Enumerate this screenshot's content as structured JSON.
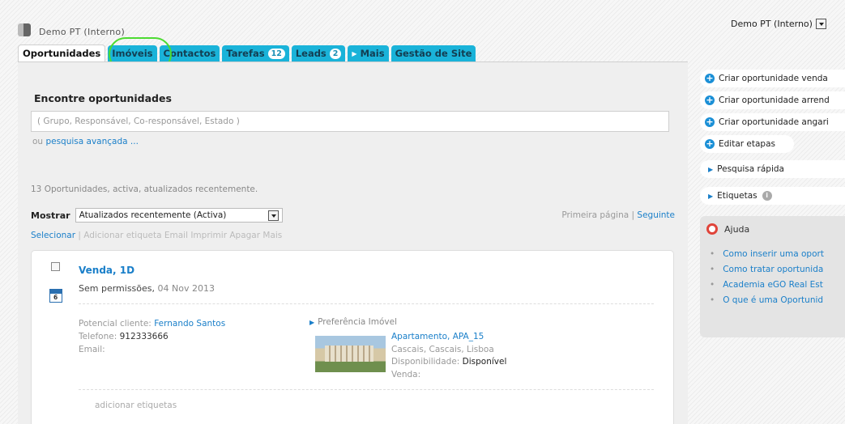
{
  "header": {
    "brand": "Demo PT (Interno)",
    "account_select": "Demo PT (Interno)"
  },
  "tabs": [
    {
      "label": "Oportunidades"
    },
    {
      "label": "Imóveis"
    },
    {
      "label": "Contactos"
    },
    {
      "label": "Tarefas",
      "badge": "12"
    },
    {
      "label": "Leads",
      "badge": "2"
    },
    {
      "label": "Mais"
    },
    {
      "label": "Gestão de Site"
    }
  ],
  "search": {
    "title": "Encontre oportunidades",
    "placeholder": "( Grupo, Responsável, Co-responsável, Estado )",
    "adv_prefix": "ou",
    "adv_link": "pesquisa avançada ..."
  },
  "results": {
    "count_text": "13 Oportunidades, activa, atualizados recentemente.",
    "show_label": "Mostrar",
    "show_value": "Atualizados recentemente (Activa)",
    "first_page": "Primeira página",
    "pager_sep": "|",
    "next": "Seguinte",
    "select": "Selecionar",
    "actions_sep": "|",
    "actions": "Adicionar etiqueta Email Imprimir Apagar Mais"
  },
  "card": {
    "title": "Venda, 1D",
    "permissions": "Sem permissões,",
    "date": "04 Nov 2013",
    "calendar_day": "6",
    "client_label": "Potencial cliente:",
    "client_name": "Fernando Santos",
    "phone_label": "Telefone:",
    "phone": "912333666",
    "email_label": "Email:",
    "pref_heading": "Preferência Imóvel",
    "property_name": "Apartamento, APA_15",
    "property_location": "Cascais, Cascais, Lisboa",
    "availability_label": "Disponibilidade:",
    "availability": "Disponível",
    "sale_label": "Venda:",
    "add_tags": "adicionar etiquetas"
  },
  "sidebar": {
    "create_sale": "Criar oportunidade venda",
    "create_rent": "Criar oportunidade arrend",
    "create_acq": "Criar oportunidade angari",
    "edit_stages": "Editar etapas",
    "quick_search": "Pesquisa rápida",
    "labels": "Etiquetas",
    "help_title": "Ajuda",
    "help_links": [
      "Como inserir uma oport",
      "Como tratar oportunida",
      "Academia eGO Real Est",
      "O que é uma Oportunid"
    ]
  }
}
